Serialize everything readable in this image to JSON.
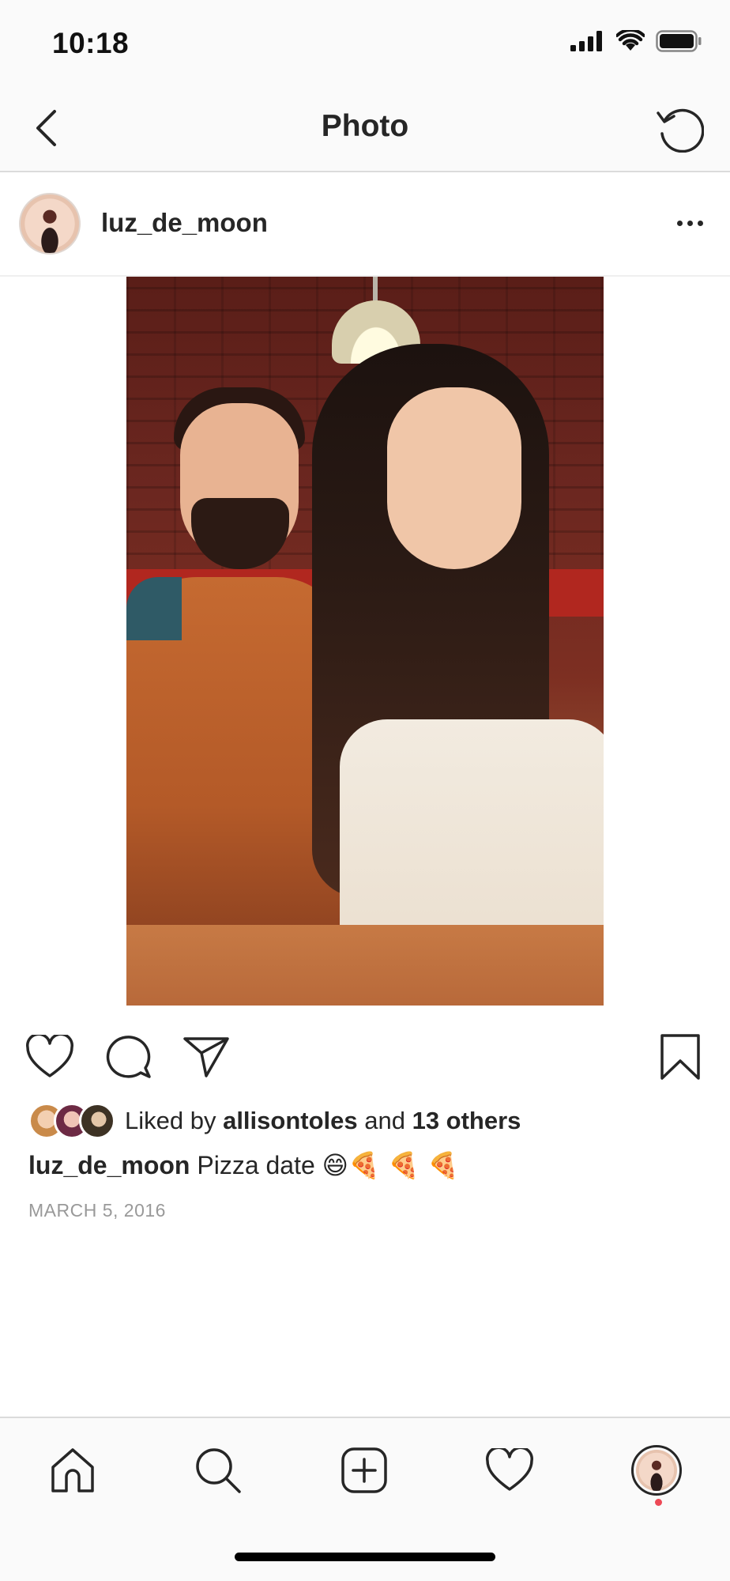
{
  "status_bar": {
    "time": "10:18",
    "icons": [
      "signal-icon",
      "wifi-icon",
      "battery-icon"
    ]
  },
  "nav": {
    "title": "Photo",
    "back_icon": "chevron-left-icon",
    "refresh_icon": "refresh-icon"
  },
  "post": {
    "username": "luz_de_moon",
    "more_icon": "more-horizontal-icon",
    "actions": [
      "heart-icon",
      "comment-icon",
      "share-icon",
      "bookmark-icon"
    ],
    "likes": {
      "prefix": "Liked by ",
      "user": "allisontoles",
      "middle": " and ",
      "others": "13 others"
    },
    "caption": {
      "username": "luz_de_moon",
      "text": " Pizza date ",
      "emojis": "😄🍕 🍕 🍕"
    },
    "date": "MARCH 5, 2016"
  },
  "tab_bar": {
    "items": [
      "home-icon",
      "search-icon",
      "add-post-icon",
      "activity-heart-icon",
      "profile-avatar"
    ]
  },
  "colors": {
    "text": "#262626",
    "secondary_text": "#999999",
    "divider": "#dbdbdb",
    "bar_background": "#fafafa",
    "notification_dot": "#ed4956"
  }
}
